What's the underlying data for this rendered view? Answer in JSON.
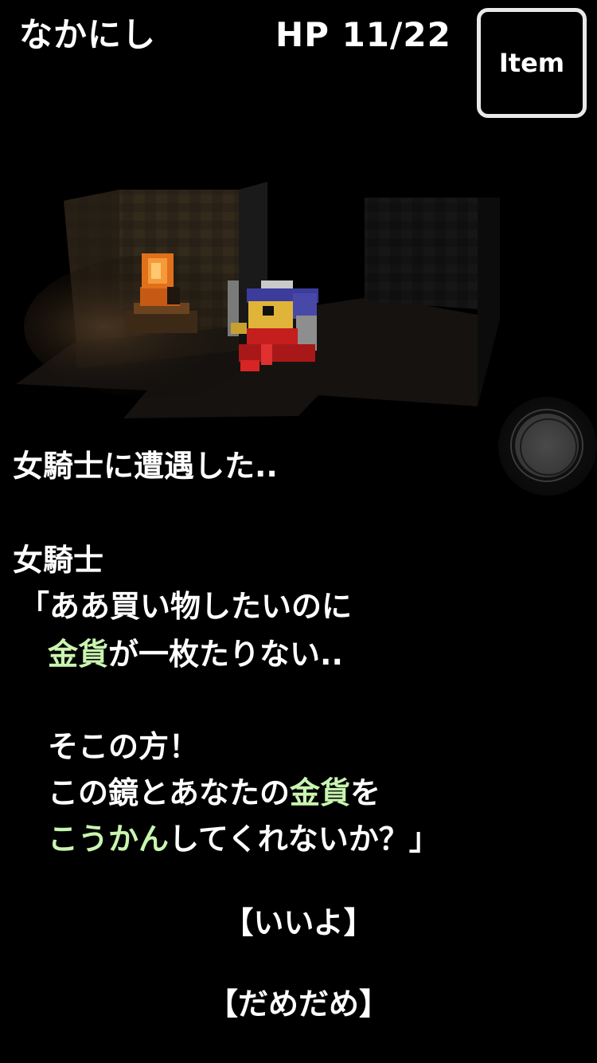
{
  "header": {
    "player_name": "なかにし",
    "hp_label": "HP",
    "hp_current": "11",
    "hp_separator": "/",
    "hp_max": "22",
    "item_button_label": "Item"
  },
  "dialog": {
    "encounter": "女騎士に遭遇した..",
    "speaker": "女騎士",
    "line1": "「ああ買い物したいのに",
    "line2_hl": "金貨",
    "line2_rest": "が一枚たりない..",
    "line3": "そこの方！",
    "line4_a": "この鏡とあなたの",
    "line4_hl": "金貨",
    "line4_b": "を",
    "line5_hl": "こうかん",
    "line5_rest": "してくれないか？」"
  },
  "choices": {
    "yes": "【いいよ】",
    "no": "【だめだめ】"
  },
  "colors": {
    "background": "#000000",
    "highlight": "#c8f5b0",
    "item_border": "#e9e9e9"
  }
}
